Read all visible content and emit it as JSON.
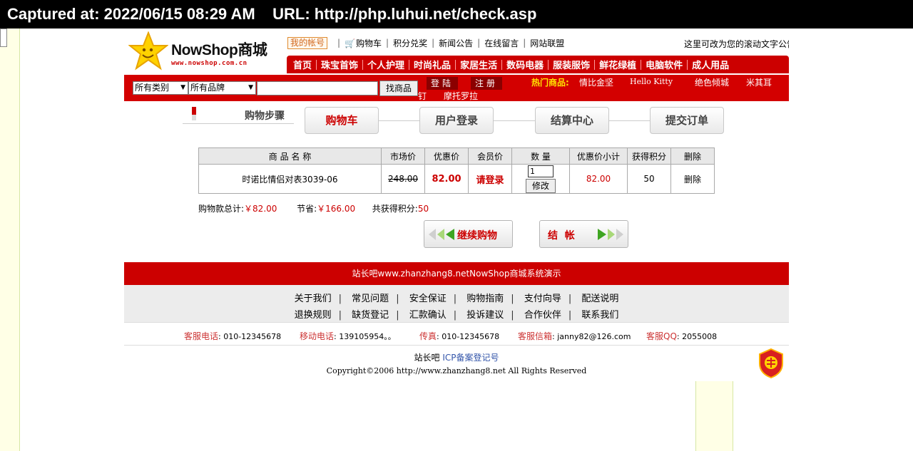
{
  "capture": {
    "text": "Captured at: 2022/06/15 08:29 AM    URL: http://php.luhui.net/check.asp"
  },
  "header": {
    "logo_name": "NowShop商城",
    "logo_url": "www.nowshop.com.cn",
    "account_label": "我的帐号",
    "top_links": [
      "购物车",
      "积分兑奖",
      "新闻公告",
      "在线留言",
      "网站联盟"
    ],
    "scroll_text": "这里可改为您的滚动文字公告"
  },
  "nav": [
    "首页",
    "珠宝首饰",
    "个人护理",
    "时尚礼品",
    "家居生活",
    "数码电器",
    "服装服饰",
    "鲜花绿植",
    "电脑软件",
    "成人用品"
  ],
  "search": {
    "category": "所有类别",
    "brand": "所有品牌",
    "find_label": "找商品",
    "login_label": "登陆",
    "register_label": "注册",
    "hot_label": "热门商品:",
    "hot_items": [
      "情比金坚",
      "Hello Kitty",
      "绝色倾城",
      "米其耳",
      "钉",
      "摩托罗拉"
    ]
  },
  "steps": {
    "title": "购物步骤",
    "items": [
      "购物车",
      "用户登录",
      "结算中心",
      "提交订单"
    ]
  },
  "cart": {
    "headers": [
      "商 品 名 称",
      "市场价",
      "优惠价",
      "会员价",
      "数 量",
      "优惠价小计",
      "获得积分",
      "删除"
    ],
    "row": {
      "name": "时诺比情侣对表3039-06",
      "market_price": "248.00",
      "sale_price": "82.00",
      "member_price": "请登录",
      "quantity": "1",
      "modify_label": "修改",
      "subtotal": "82.00",
      "points": "50",
      "delete_label": "删除"
    }
  },
  "summary": {
    "total_label": "购物款总计:",
    "total_value": "￥82.00",
    "save_label": "节省:",
    "save_value": "￥166.00",
    "points_label": "共获得积分:",
    "points_value": "50"
  },
  "buttons": {
    "continue": "继续购物",
    "checkout": "结  帐"
  },
  "footer": {
    "bar_text": "站长吧www.zhanzhang8.netNowShop商城系统演示",
    "links_row1": [
      "关于我们",
      "常见问题",
      "安全保证",
      "购物指南",
      "支付向导",
      "配送说明"
    ],
    "links_row2": [
      "退换规则",
      "缺货登记",
      "汇款确认",
      "投诉建议",
      "合作伙伴",
      "联系我们"
    ],
    "contacts": [
      {
        "k": "客服电话",
        "v": ": 010-12345678"
      },
      {
        "k": "移动电话",
        "v": ": 139105954。。"
      },
      {
        "k": "传真",
        "v": ": 010-12345678"
      },
      {
        "k": "客服信箱",
        "v": ": janny82@126.com"
      },
      {
        "k": "客服QQ",
        "v": ": 2055008"
      }
    ],
    "icp_site": "站长吧",
    "icp_link": "ICP备案登记号",
    "copyright": "Copyright©2006 http://www.zhanzhang8.net All Rights Reserved"
  },
  "colors": {
    "brand_red": "#cc0000",
    "hot_yellow": "#ffe400",
    "page_bg": "#ffffe6"
  }
}
